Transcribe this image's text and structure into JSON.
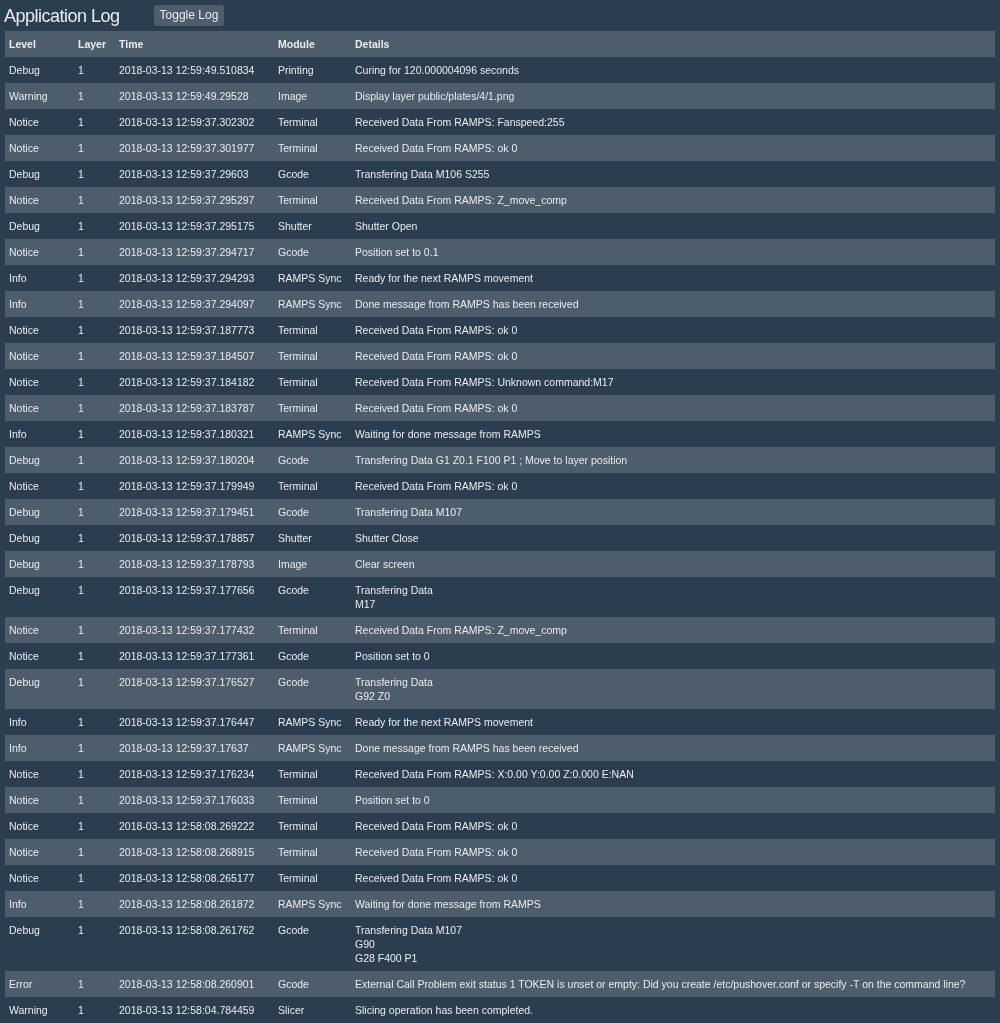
{
  "title": "Application Log",
  "toggle_button": "Toggle Log",
  "table": {
    "columns": [
      "Level",
      "Layer",
      "Time",
      "Module",
      "Details"
    ],
    "rows": [
      [
        "Debug",
        "1",
        "2018-03-13 12:59:49.510834",
        "Printing",
        "Curing for 120.000004096 seconds"
      ],
      [
        "Warning",
        "1",
        "2018-03-13 12:59:49.29528",
        "Image",
        "Display layer public/plates/4/1.png"
      ],
      [
        "Notice",
        "1",
        "2018-03-13 12:59:37.302302",
        "Terminal",
        "Received Data From RAMPS: Fanspeed:255"
      ],
      [
        "Notice",
        "1",
        "2018-03-13 12:59:37.301977",
        "Terminal",
        "Received Data From RAMPS: ok 0"
      ],
      [
        "Debug",
        "1",
        "2018-03-13 12:59:37.29603",
        "Gcode",
        "Transfering Data M106 S255"
      ],
      [
        "Notice",
        "1",
        "2018-03-13 12:59:37.295297",
        "Terminal",
        "Received Data From RAMPS: Z_move_comp"
      ],
      [
        "Debug",
        "1",
        "2018-03-13 12:59:37.295175",
        "Shutter",
        "Shutter Open"
      ],
      [
        "Notice",
        "1",
        "2018-03-13 12:59:37.294717",
        "Gcode",
        "Position set to 0.1"
      ],
      [
        "Info",
        "1",
        "2018-03-13 12:59:37.294293",
        "RAMPS Sync",
        "Ready for the next RAMPS movement"
      ],
      [
        "Info",
        "1",
        "2018-03-13 12:59:37.294097",
        "RAMPS Sync",
        "Done message from RAMPS has been received"
      ],
      [
        "Notice",
        "1",
        "2018-03-13 12:59:37.187773",
        "Terminal",
        "Received Data From RAMPS: ok 0"
      ],
      [
        "Notice",
        "1",
        "2018-03-13 12:59:37.184507",
        "Terminal",
        "Received Data From RAMPS: ok 0"
      ],
      [
        "Notice",
        "1",
        "2018-03-13 12:59:37.184182",
        "Terminal",
        "Received Data From RAMPS: Unknown command:M17"
      ],
      [
        "Notice",
        "1",
        "2018-03-13 12:59:37.183787",
        "Terminal",
        "Received Data From RAMPS: ok 0"
      ],
      [
        "Info",
        "1",
        "2018-03-13 12:59:37.180321",
        "RAMPS Sync",
        "Waiting for done message from RAMPS"
      ],
      [
        "Debug",
        "1",
        "2018-03-13 12:59:37.180204",
        "Gcode",
        "Transfering Data G1 Z0.1 F100 P1 ; Move to layer position"
      ],
      [
        "Notice",
        "1",
        "2018-03-13 12:59:37.179949",
        "Terminal",
        "Received Data From RAMPS: ok 0"
      ],
      [
        "Debug",
        "1",
        "2018-03-13 12:59:37.179451",
        "Gcode",
        "Transfering Data M107"
      ],
      [
        "Debug",
        "1",
        "2018-03-13 12:59:37.178857",
        "Shutter",
        "Shutter Close"
      ],
      [
        "Debug",
        "1",
        "2018-03-13 12:59:37.178793",
        "Image",
        "Clear screen"
      ],
      [
        "Debug",
        "1",
        "2018-03-13 12:59:37.177656",
        "Gcode",
        "Transfering Data\nM17"
      ],
      [
        "Notice",
        "1",
        "2018-03-13 12:59:37.177432",
        "Terminal",
        "Received Data From RAMPS: Z_move_comp"
      ],
      [
        "Notice",
        "1",
        "2018-03-13 12:59:37.177361",
        "Gcode",
        "Position set to 0"
      ],
      [
        "Debug",
        "1",
        "2018-03-13 12:59:37.176527",
        "Gcode",
        "Transfering Data\nG92 Z0"
      ],
      [
        "Info",
        "1",
        "2018-03-13 12:59:37.176447",
        "RAMPS Sync",
        "Ready for the next RAMPS movement"
      ],
      [
        "Info",
        "1",
        "2018-03-13 12:59:37.17637",
        "RAMPS Sync",
        "Done message from RAMPS has been received"
      ],
      [
        "Notice",
        "1",
        "2018-03-13 12:59:37.176234",
        "Terminal",
        "Received Data From RAMPS: X:0.00 Y:0.00 Z:0.000 E:NAN"
      ],
      [
        "Notice",
        "1",
        "2018-03-13 12:59:37.176033",
        "Terminal",
        "Position set to 0"
      ],
      [
        "Notice",
        "1",
        "2018-03-13 12:58:08.269222",
        "Terminal",
        "Received Data From RAMPS: ok 0"
      ],
      [
        "Notice",
        "1",
        "2018-03-13 12:58:08.268915",
        "Terminal",
        "Received Data From RAMPS: ok 0"
      ],
      [
        "Notice",
        "1",
        "2018-03-13 12:58:08.265177",
        "Terminal",
        "Received Data From RAMPS: ok 0"
      ],
      [
        "Info",
        "1",
        "2018-03-13 12:58:08.261872",
        "RAMPS Sync",
        "Waiting for done message from RAMPS"
      ],
      [
        "Debug",
        "1",
        "2018-03-13 12:58:08.261762",
        "Gcode",
        "Transfering Data M107\nG90\nG28 F400 P1"
      ],
      [
        "Error",
        "1",
        "2018-03-13 12:58:08.260901",
        "Gcode",
        "External Call Problem exit status 1 TOKEN is unset or empty: Did you create /etc/pushover.conf or specify -T on the command line?"
      ],
      [
        "Warning",
        "1",
        "2018-03-13 12:58:04.784459",
        "Slicer",
        "Slicing operation has been completed."
      ]
    ]
  }
}
